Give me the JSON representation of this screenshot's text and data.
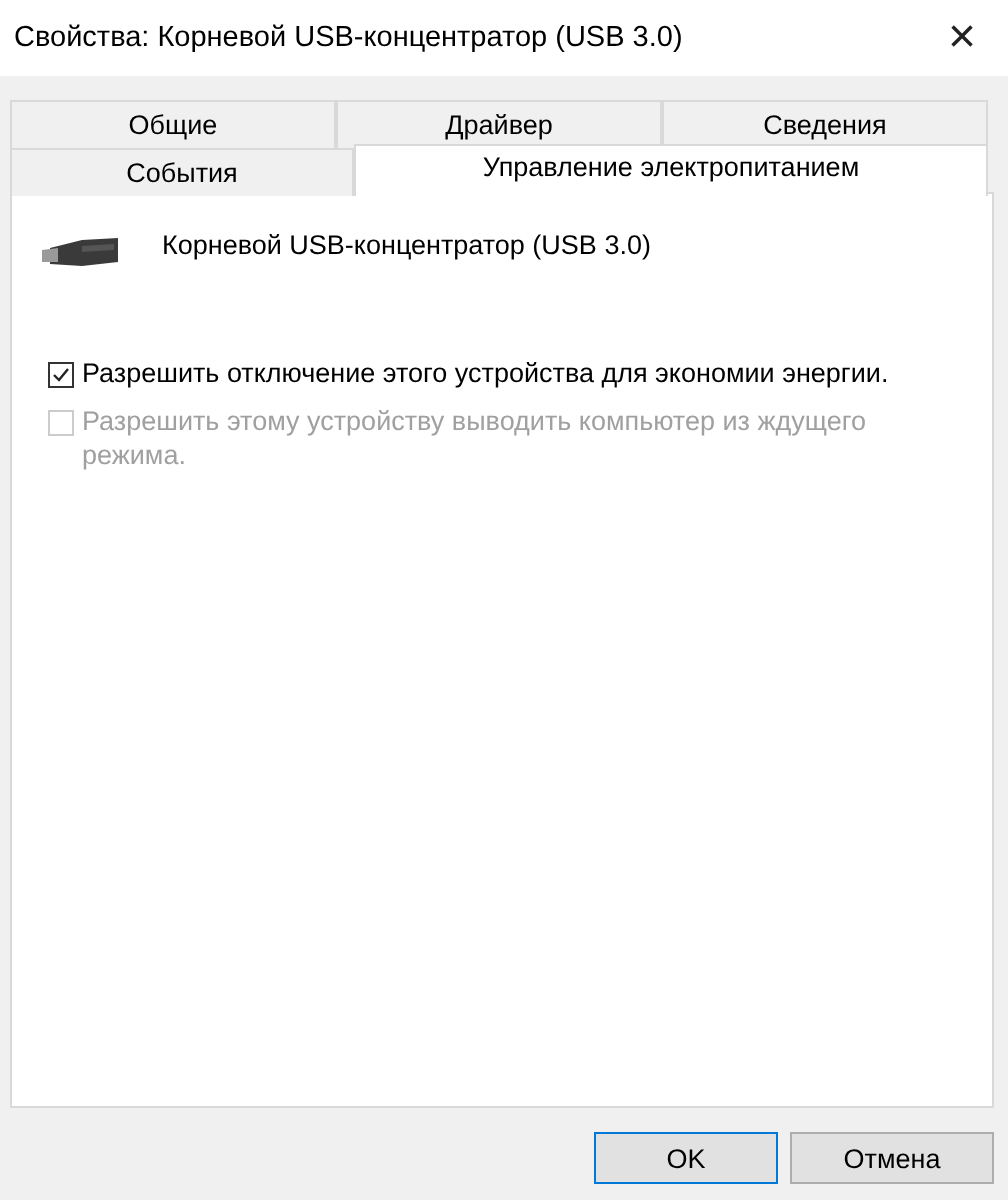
{
  "window": {
    "title": "Свойства: Корневой USB-концентратор (USB 3.0)",
    "close": "×"
  },
  "tab_rows": [
    {
      "tabs": [
        {
          "label": "Общие",
          "selected": false
        },
        {
          "label": "Драйвер",
          "selected": false
        },
        {
          "label": "Сведения",
          "selected": false
        }
      ]
    },
    {
      "tabs": [
        {
          "label": "События",
          "selected": false
        },
        {
          "label": "Управление электропитанием",
          "selected": true
        }
      ]
    }
  ],
  "device": {
    "name": "Корневой USB-концентратор (USB 3.0)"
  },
  "options": [
    {
      "label": "Разрешить отключение этого устройства для экономии энергии.",
      "checked": true,
      "disabled": false
    },
    {
      "label": "Разрешить этому устройству выводить компьютер из ждущего режима.",
      "checked": false,
      "disabled": true
    }
  ],
  "buttons": [
    {
      "label": "OK",
      "default": true
    },
    {
      "label": "Отмена",
      "default": false
    }
  ]
}
